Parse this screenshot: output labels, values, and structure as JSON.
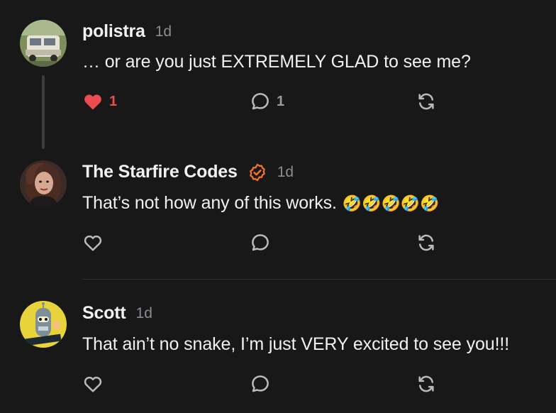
{
  "posts": [
    {
      "author": "polistra",
      "time": "1d",
      "text": "… or are you just EXTREMELY GLAD to see me?",
      "verified": false,
      "liked": true,
      "likes": "1",
      "replies": "1",
      "avatar": "van-photo"
    },
    {
      "author": "The Starfire Codes",
      "time": "1d",
      "text": "That’s not how any of this works.",
      "emoji": "🤣🤣🤣🤣🤣",
      "verified": true,
      "liked": false,
      "likes": "",
      "replies": "",
      "avatar": "woman-portrait"
    },
    {
      "author": "Scott",
      "time": "1d",
      "text": "That ain’t no snake, I’m just VERY excited to see you!!!",
      "verified": false,
      "liked": false,
      "likes": "",
      "replies": "",
      "avatar": "robot-cartoon"
    }
  ],
  "icons": {
    "like": "heart-icon",
    "reply": "comment-icon",
    "repost": "repost-icon",
    "verified": "verified-badge-icon"
  },
  "colors": {
    "background": "#181819",
    "text": "#f1f1f3",
    "muted": "#8b8b92",
    "like": "#ea4c50",
    "verified": "#f0712c"
  }
}
